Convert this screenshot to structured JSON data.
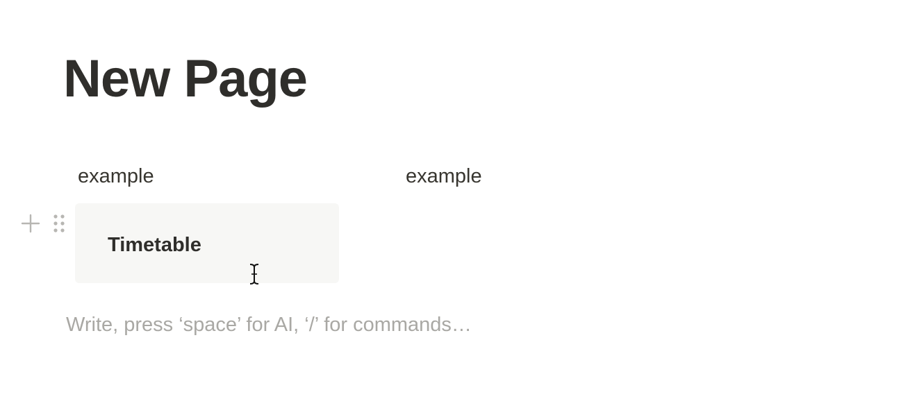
{
  "page": {
    "title": "New Page"
  },
  "columns": {
    "left_label": "example",
    "right_label": "example"
  },
  "block": {
    "title": "Timetable"
  },
  "editor": {
    "placeholder": "Write, press ‘space’ for AI, ‘/’ for commands…"
  },
  "icons": {
    "add_block": "plus-icon",
    "drag_handle": "drag-handle-icon",
    "text_cursor": "text-cursor-icon"
  },
  "colors": {
    "title_text": "#2f2e2b",
    "body_text": "#37352f",
    "placeholder_text": "#a9a8a4",
    "card_background": "#f7f7f5",
    "handle_icon": "#b7b6b2"
  }
}
